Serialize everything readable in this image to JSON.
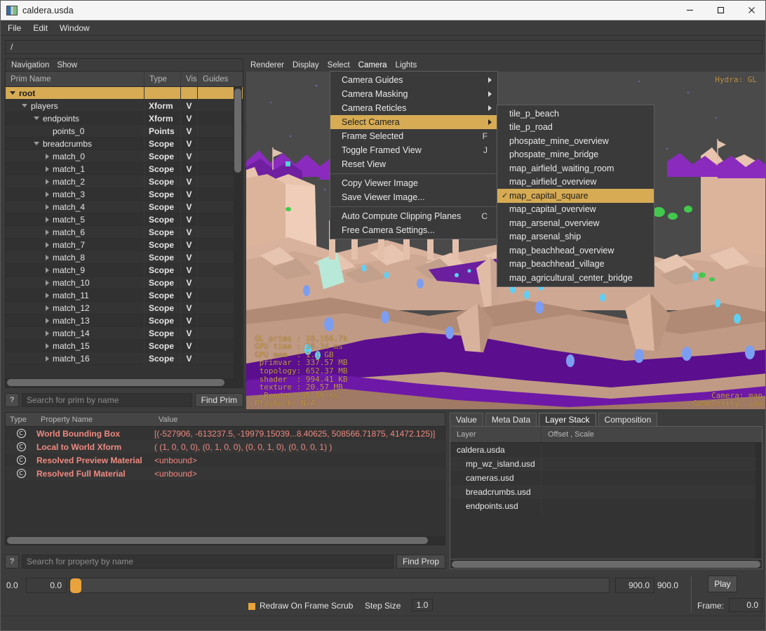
{
  "window": {
    "title": "caldera.usda",
    "icon": "usd-file-icon",
    "minimize": "minimize-icon",
    "maximize": "maximize-icon",
    "close": "close-icon"
  },
  "menubar": {
    "items": [
      "File",
      "Edit",
      "Window"
    ]
  },
  "pathbar": {
    "value": "/"
  },
  "prim_panel": {
    "menu": [
      "Navigation",
      "Show"
    ],
    "columns": [
      "Prim Name",
      "Type",
      "Vis",
      "Guides"
    ],
    "rows": [
      {
        "name": "root",
        "type": "",
        "vis": "",
        "depth": 0,
        "twisty": "down",
        "selected": true
      },
      {
        "name": "players",
        "type": "Xform",
        "vis": "V",
        "depth": 1,
        "twisty": "down",
        "selected": false
      },
      {
        "name": "endpoints",
        "type": "Xform",
        "vis": "V",
        "depth": 2,
        "twisty": "down",
        "selected": false
      },
      {
        "name": "points_0",
        "type": "Points",
        "vis": "V",
        "depth": 3,
        "twisty": "none",
        "selected": false
      },
      {
        "name": "breadcrumbs",
        "type": "Scope",
        "vis": "V",
        "depth": 2,
        "twisty": "down",
        "selected": false
      },
      {
        "name": "match_0",
        "type": "Scope",
        "vis": "V",
        "depth": 3,
        "twisty": "right",
        "selected": false
      },
      {
        "name": "match_1",
        "type": "Scope",
        "vis": "V",
        "depth": 3,
        "twisty": "right",
        "selected": false
      },
      {
        "name": "match_2",
        "type": "Scope",
        "vis": "V",
        "depth": 3,
        "twisty": "right",
        "selected": false
      },
      {
        "name": "match_3",
        "type": "Scope",
        "vis": "V",
        "depth": 3,
        "twisty": "right",
        "selected": false
      },
      {
        "name": "match_4",
        "type": "Scope",
        "vis": "V",
        "depth": 3,
        "twisty": "right",
        "selected": false
      },
      {
        "name": "match_5",
        "type": "Scope",
        "vis": "V",
        "depth": 3,
        "twisty": "right",
        "selected": false
      },
      {
        "name": "match_6",
        "type": "Scope",
        "vis": "V",
        "depth": 3,
        "twisty": "right",
        "selected": false
      },
      {
        "name": "match_7",
        "type": "Scope",
        "vis": "V",
        "depth": 3,
        "twisty": "right",
        "selected": false
      },
      {
        "name": "match_8",
        "type": "Scope",
        "vis": "V",
        "depth": 3,
        "twisty": "right",
        "selected": false
      },
      {
        "name": "match_9",
        "type": "Scope",
        "vis": "V",
        "depth": 3,
        "twisty": "right",
        "selected": false
      },
      {
        "name": "match_10",
        "type": "Scope",
        "vis": "V",
        "depth": 3,
        "twisty": "right",
        "selected": false
      },
      {
        "name": "match_11",
        "type": "Scope",
        "vis": "V",
        "depth": 3,
        "twisty": "right",
        "selected": false
      },
      {
        "name": "match_12",
        "type": "Scope",
        "vis": "V",
        "depth": 3,
        "twisty": "right",
        "selected": false
      },
      {
        "name": "match_13",
        "type": "Scope",
        "vis": "V",
        "depth": 3,
        "twisty": "right",
        "selected": false
      },
      {
        "name": "match_14",
        "type": "Scope",
        "vis": "V",
        "depth": 3,
        "twisty": "right",
        "selected": false
      },
      {
        "name": "match_15",
        "type": "Scope",
        "vis": "V",
        "depth": 3,
        "twisty": "right",
        "selected": false
      },
      {
        "name": "match_16",
        "type": "Scope",
        "vis": "V",
        "depth": 3,
        "twisty": "right",
        "selected": false
      }
    ],
    "search": {
      "help": "?",
      "placeholder": "Search for prim by name",
      "button": "Find Prim"
    }
  },
  "viewport": {
    "menu": [
      "Renderer",
      "Display",
      "Select",
      "Camera",
      "Lights"
    ],
    "active_menu": "Camera",
    "hud_top_right": "Hydra: GL",
    "hud_left": "GL prims : 18,166,7k\nGPU time : 30.34 ms\nGPU mem  : 1.1 GB\n primvar : 337.57 MB\n topology: 652.37 MB\n shader  : 994.41 KB\n texture : 20.57 MB\n  Render: 35.39 ms\nPlayback: N/A",
    "hud_right": "Camera: map\nComplexity: Low"
  },
  "camera_menu": {
    "items": [
      {
        "label": "Camera Guides",
        "shortcut": "",
        "submenu": true,
        "highlight": false,
        "sep_after": false
      },
      {
        "label": "Camera Masking",
        "shortcut": "",
        "submenu": true,
        "highlight": false,
        "sep_after": false
      },
      {
        "label": "Camera Reticles",
        "shortcut": "",
        "submenu": true,
        "highlight": false,
        "sep_after": false
      },
      {
        "label": "Select Camera",
        "shortcut": "",
        "submenu": true,
        "highlight": true,
        "sep_after": false
      },
      {
        "label": "Frame Selected",
        "shortcut": "F",
        "submenu": false,
        "highlight": false,
        "sep_after": false
      },
      {
        "label": "Toggle Framed View",
        "shortcut": "J",
        "submenu": false,
        "highlight": false,
        "sep_after": false
      },
      {
        "label": "Reset View",
        "shortcut": "",
        "submenu": false,
        "highlight": false,
        "sep_after": true
      },
      {
        "label": "Copy Viewer Image",
        "shortcut": "",
        "submenu": false,
        "highlight": false,
        "sep_after": false
      },
      {
        "label": "Save Viewer Image...",
        "shortcut": "",
        "submenu": false,
        "highlight": false,
        "sep_after": true
      },
      {
        "label": "Auto Compute Clipping Planes",
        "shortcut": "C",
        "submenu": false,
        "highlight": false,
        "sep_after": false
      },
      {
        "label": "Free Camera Settings...",
        "shortcut": "",
        "submenu": false,
        "highlight": false,
        "sep_after": false
      }
    ]
  },
  "camera_submenu": {
    "items": [
      {
        "label": "tile_p_beach",
        "checked": false
      },
      {
        "label": "tile_p_road",
        "checked": false
      },
      {
        "label": "phospate_mine_overview",
        "checked": false
      },
      {
        "label": "phospate_mine_bridge",
        "checked": false
      },
      {
        "label": "map_airfield_waiting_room",
        "checked": false
      },
      {
        "label": "map_airfield_overview",
        "checked": false
      },
      {
        "label": "map_capital_square",
        "checked": true
      },
      {
        "label": "map_capital_overview",
        "checked": false
      },
      {
        "label": "map_arsenal_overview",
        "checked": false
      },
      {
        "label": "map_arsenal_ship",
        "checked": false
      },
      {
        "label": "map_beachhead_overview",
        "checked": false
      },
      {
        "label": "map_beachhead_village",
        "checked": false
      },
      {
        "label": "map_agricultural_center_bridge",
        "checked": false
      }
    ]
  },
  "property_panel": {
    "columns": [
      "Type",
      "Property Name",
      "Value"
    ],
    "rows": [
      {
        "icon": "C",
        "name": "World Bounding Box",
        "value": "[(-527906, -613237.5, -19979.15039...8.40625, 508566.71875, 41472.125)]"
      },
      {
        "icon": "C",
        "name": "Local to World Xform",
        "value": "( (1, 0, 0, 0), (0, 1, 0, 0), (0, 0, 1, 0), (0, 0, 0, 1) )"
      },
      {
        "icon": "C",
        "name": "Resolved Preview Material",
        "value": "<unbound>"
      },
      {
        "icon": "C",
        "name": "Resolved Full Material",
        "value": "<unbound>"
      }
    ],
    "search": {
      "help": "?",
      "placeholder": "Search for property by name",
      "button": "Find Prop"
    }
  },
  "right_panel": {
    "tabs": [
      {
        "label": "Value",
        "active": false
      },
      {
        "label": "Meta Data",
        "active": false
      },
      {
        "label": "Layer Stack",
        "active": true
      },
      {
        "label": "Composition",
        "active": false
      }
    ],
    "columns": [
      "Layer",
      "Offset , Scale"
    ],
    "rows": [
      {
        "name": "caldera.usda",
        "offset": "",
        "depth": 0
      },
      {
        "name": "mp_wz_island.usd",
        "offset": "",
        "depth": 1
      },
      {
        "name": "cameras.usd",
        "offset": "",
        "depth": 1
      },
      {
        "name": "breadcrumbs.usd",
        "offset": "",
        "depth": 1
      },
      {
        "name": "endpoints.usd",
        "offset": "",
        "depth": 1
      }
    ]
  },
  "timeline": {
    "start_label": "0.0",
    "start_value": "0.0",
    "end_value": "900.0",
    "end_label": "900.0",
    "play_button": "Play",
    "redraw_label": "Redraw On Frame Scrub",
    "redraw_checked": true,
    "step_label": "Step Size",
    "step_value": "1.0",
    "frame_label": "Frame:",
    "frame_value": "0.0"
  },
  "colors": {
    "accent": "#d6ab54",
    "panel_bg": "#333333",
    "window_bg": "#3c3c3c",
    "property_text": "#f08a80",
    "hud_text": "#c49a4a",
    "timeline_handle": "#e8a33d"
  }
}
